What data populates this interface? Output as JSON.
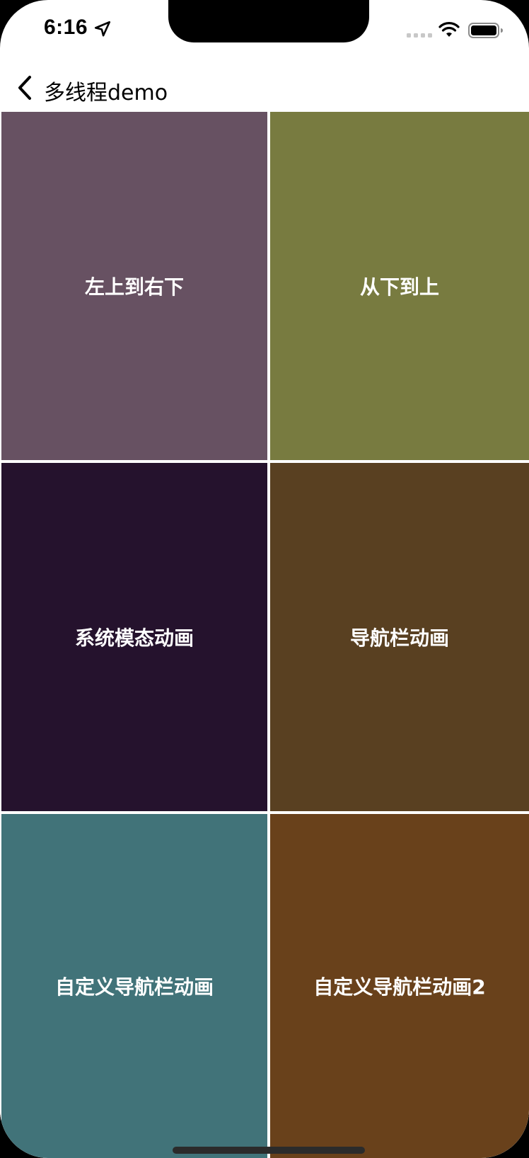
{
  "status_bar": {
    "time": "6:16"
  },
  "nav": {
    "title": "多线程demo"
  },
  "grid": {
    "cells": [
      {
        "label": "左上到右下",
        "color": "#675162"
      },
      {
        "label": "从下到上",
        "color": "#787b40"
      },
      {
        "label": "系统模态动画",
        "color": "#25122d"
      },
      {
        "label": "导航栏动画",
        "color": "#594021"
      },
      {
        "label": "自定义导航栏动画",
        "color": "#417379"
      },
      {
        "label": "自定义导航栏动画2",
        "color": "#69411b"
      }
    ]
  },
  "icons": {
    "back": "chevron-left-icon",
    "location": "location-arrow-icon",
    "signal": "cellular-signal-icon",
    "wifi": "wifi-icon",
    "battery": "battery-icon"
  }
}
